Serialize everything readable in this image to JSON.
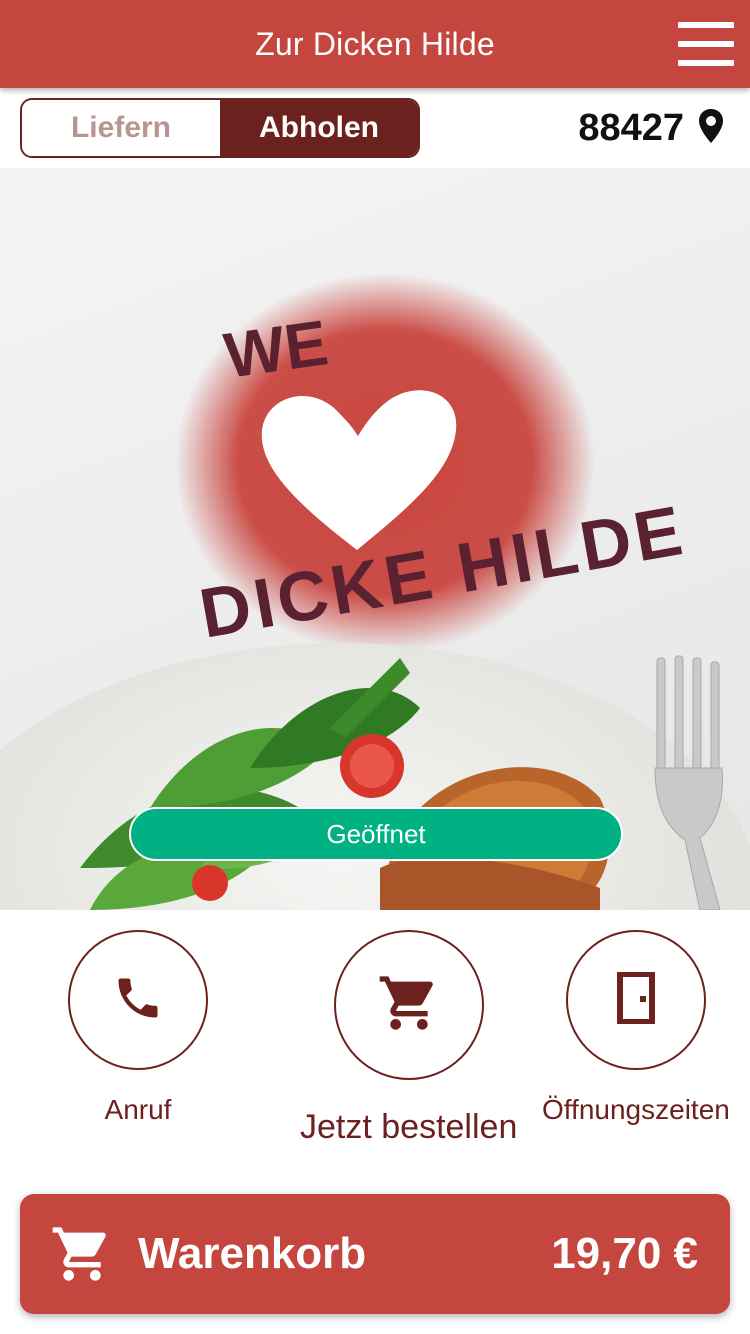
{
  "header": {
    "title": "Zur Dicken Hilde",
    "menu_icon": "hamburger-menu-icon"
  },
  "order_mode": {
    "options": [
      "Liefern",
      "Abholen"
    ],
    "selected": "Abholen"
  },
  "location": {
    "zip": "88427",
    "icon": "location-pin-icon"
  },
  "hero": {
    "logo_text_top": "WE",
    "logo_text_bottom": "DICKE HILDE",
    "status": "Geöffnet"
  },
  "actions": [
    {
      "label": "Anruf",
      "icon": "phone-icon"
    },
    {
      "label": "Jetzt bestellen",
      "icon": "cart-icon"
    },
    {
      "label": "Öffnungszeiten",
      "icon": "door-icon"
    }
  ],
  "cart": {
    "label": "Warenkorb",
    "total": "19,70 €",
    "icon": "cart-icon"
  },
  "colors": {
    "brand_red": "#c5463e",
    "dark_red": "#6b211e",
    "open_green": "#00b184"
  }
}
